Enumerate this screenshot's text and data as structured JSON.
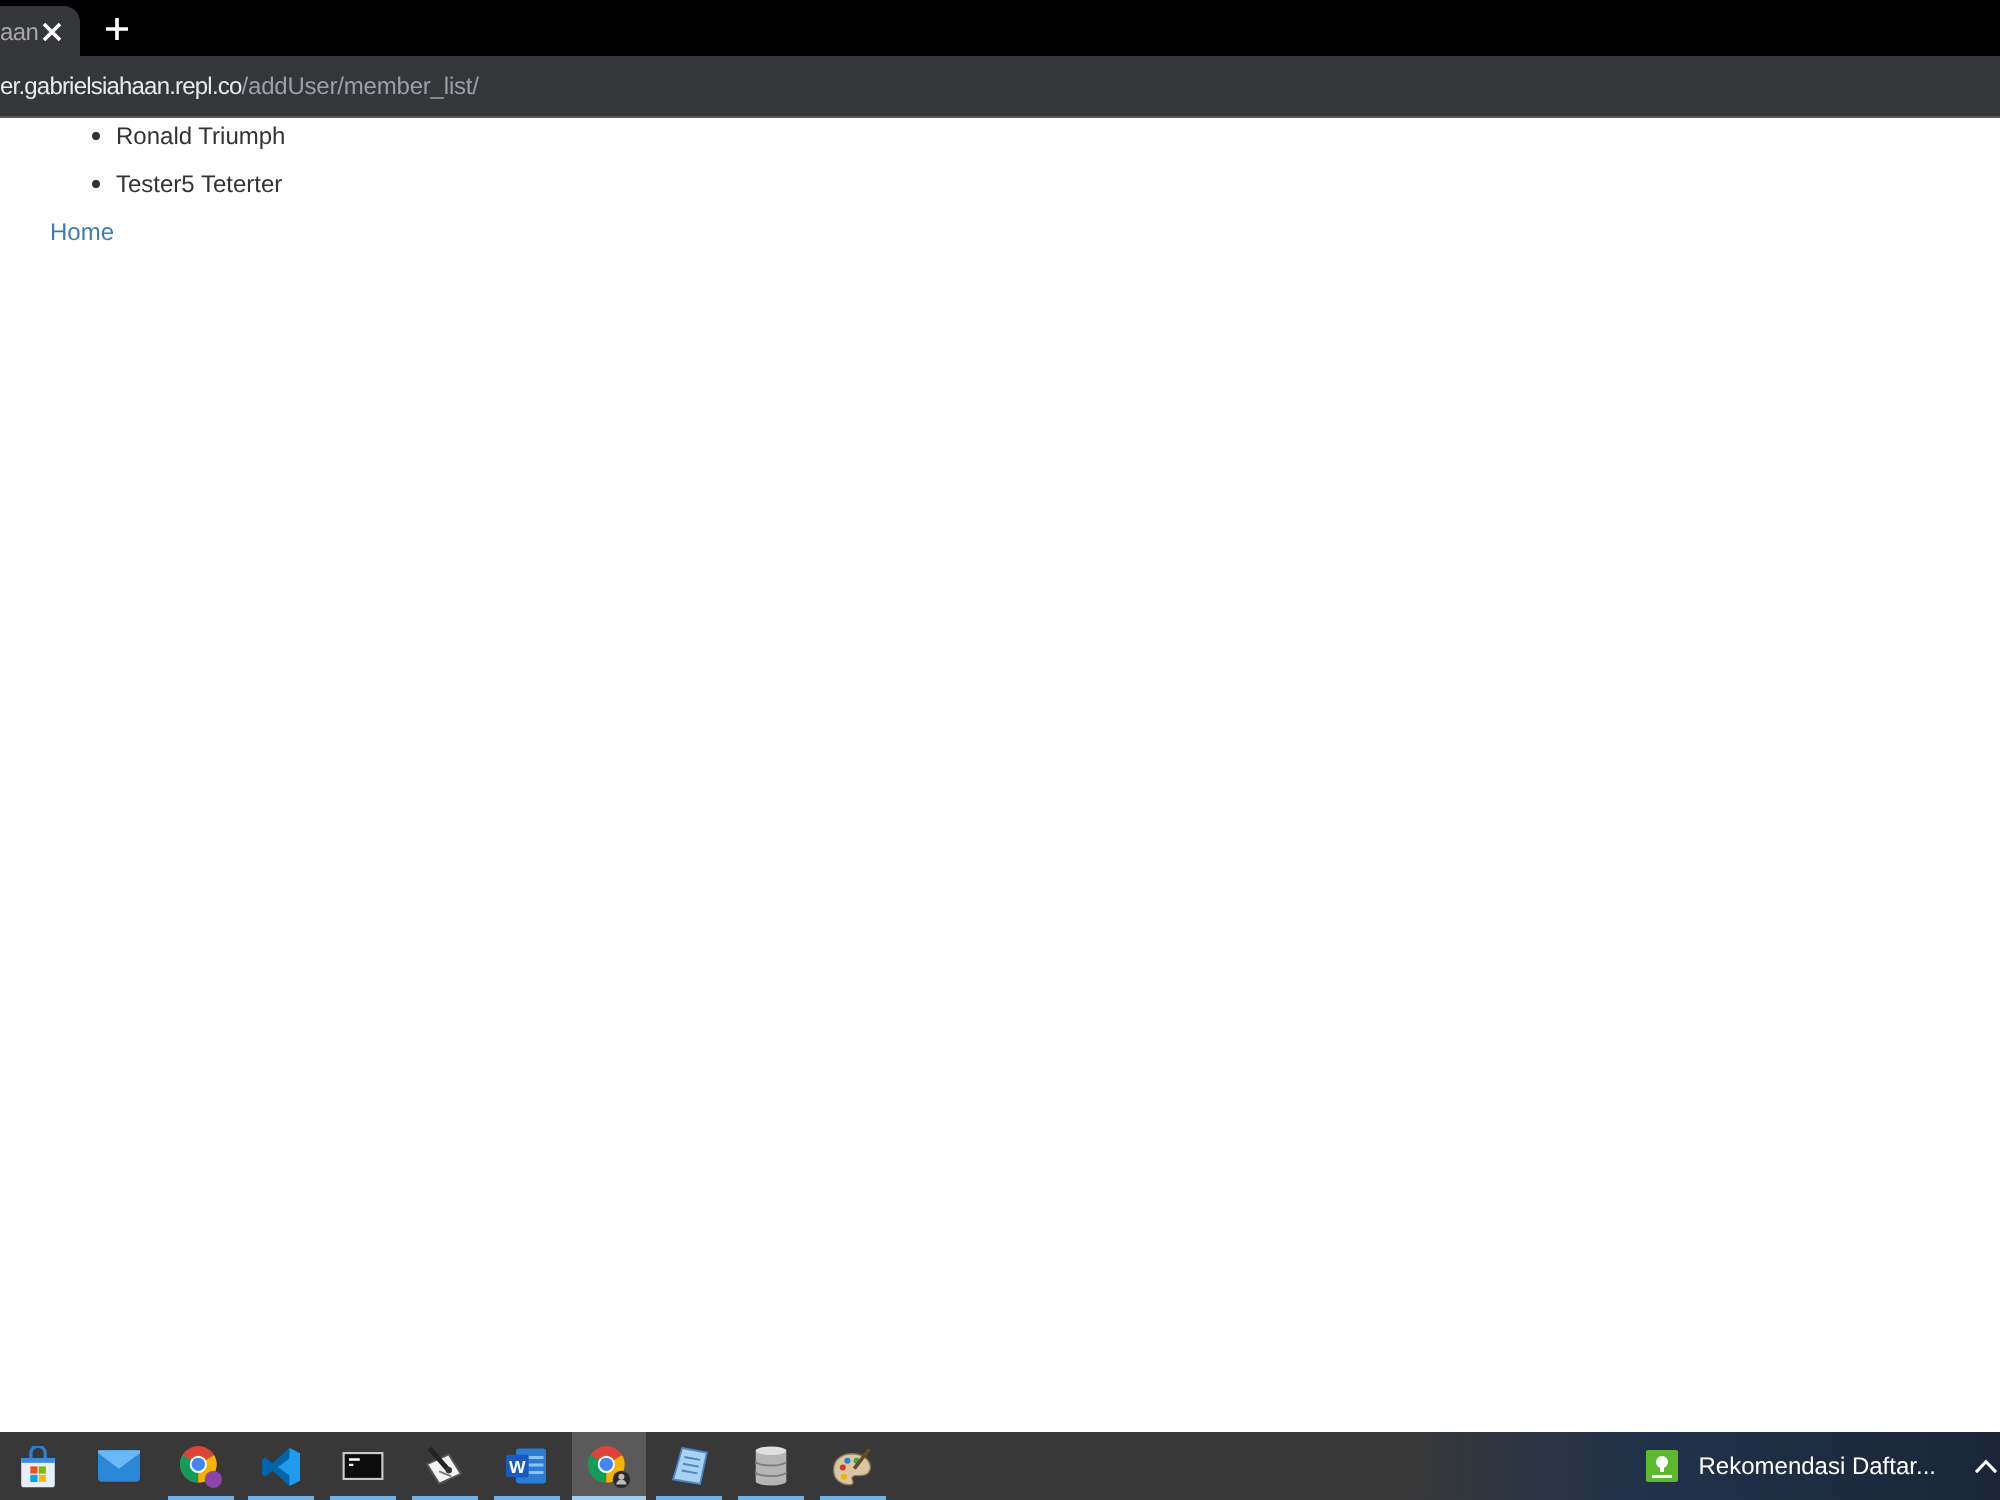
{
  "browser": {
    "tab": {
      "title": "aan",
      "selected": true
    },
    "address": {
      "host": "er.gabrielsiahaan.repl.co",
      "path": "/addUser/member_list/"
    }
  },
  "page": {
    "members": [
      {
        "name": "Ronald Triumph"
      },
      {
        "name": "Tester5 Teterter"
      }
    ],
    "home_link": "Home"
  },
  "taskbar": {
    "apps": [
      {
        "kind": "store",
        "running": false,
        "selected": false
      },
      {
        "kind": "mail",
        "running": false,
        "selected": false
      },
      {
        "kind": "browser",
        "running": true,
        "selected": false
      },
      {
        "kind": "editor",
        "running": true,
        "selected": false
      },
      {
        "kind": "terminal",
        "running": true,
        "selected": false
      },
      {
        "kind": "quill",
        "running": true,
        "selected": false
      },
      {
        "kind": "writer",
        "label": "W",
        "running": true,
        "selected": false
      },
      {
        "kind": "browserprofile",
        "running": true,
        "selected": true
      },
      {
        "kind": "notebook",
        "running": true,
        "selected": false
      },
      {
        "kind": "database",
        "running": true,
        "selected": false
      },
      {
        "kind": "palette",
        "running": true,
        "selected": false
      }
    ],
    "notification": "Rekomendasi Daftar..."
  }
}
